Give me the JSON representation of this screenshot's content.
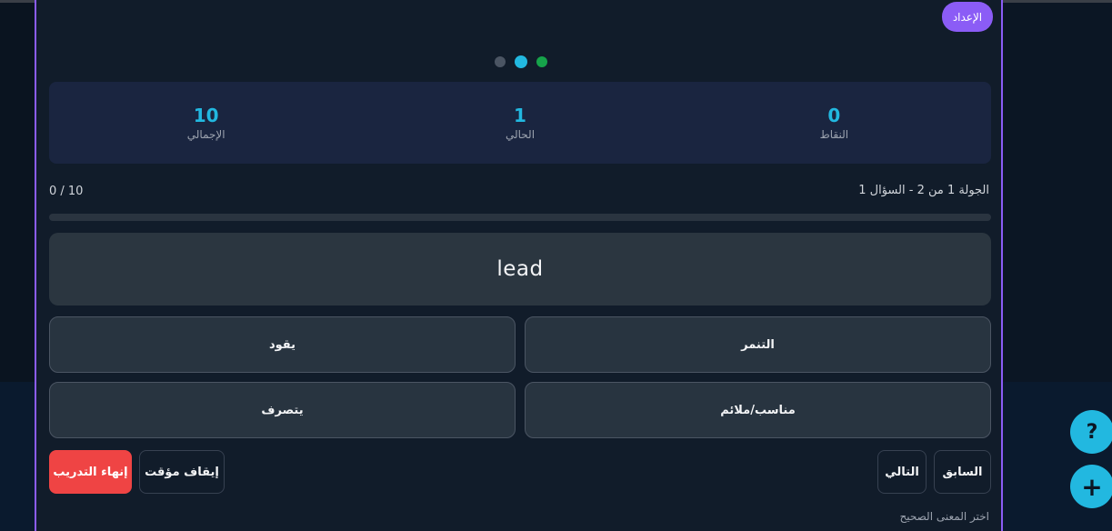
{
  "header": {
    "setup_label": "الإعداد"
  },
  "stats": {
    "points": {
      "value": "0",
      "label": "النقاط"
    },
    "current": {
      "value": "1",
      "label": "الحالي"
    },
    "total": {
      "value": "10",
      "label": "الإجمالي"
    }
  },
  "progress": {
    "round_text": "الجولة 1 من 2 - السؤال 1",
    "score_text": "0 / 10",
    "fraction": 0
  },
  "question": {
    "word": "lead"
  },
  "options": [
    {
      "label": "التنمر"
    },
    {
      "label": "يقود"
    },
    {
      "label": "مناسب/ملائم"
    },
    {
      "label": "يتصرف"
    }
  ],
  "controls": {
    "prev_label": "السابق",
    "next_label": "التالي",
    "pause_label": "إيقاف مؤقت",
    "end_label": "إنهاء التدريب"
  },
  "hint": "اختر المعنى الصحيح",
  "fab": {
    "help_glyph": "?",
    "add_glyph": "+"
  },
  "colors": {
    "accent": "#22b8e0",
    "brand": "#8b5cf6",
    "danger": "#ef4444",
    "dot_gray": "#4b5563",
    "dot_cyan": "#22b8e0",
    "dot_green": "#16a34a"
  }
}
